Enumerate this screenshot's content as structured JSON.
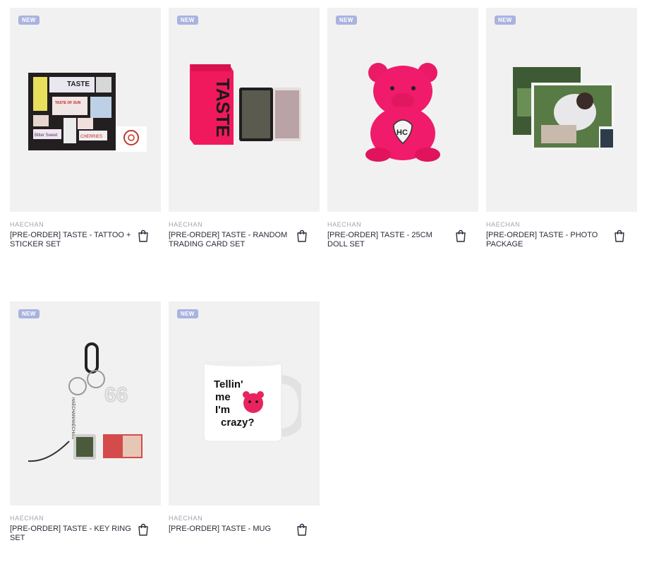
{
  "products": [
    {
      "badge": "NEW",
      "brand": "HAECHAN",
      "title": "[PRE-ORDER] TASTE - TATTOO + STICKER SET",
      "art_labels": [
        "TASTE",
        "TASTE OF SUN",
        "Bitter Sweet",
        "TASTE",
        "CHERRIES"
      ]
    },
    {
      "badge": "NEW",
      "brand": "HAECHAN",
      "title": "[PRE-ORDER] TASTE - RANDOM TRADING CARD SET",
      "art_labels": [
        "TASTE"
      ]
    },
    {
      "badge": "NEW",
      "brand": "HAECHAN",
      "title": "[PRE-ORDER] TASTE - 25CM DOLL SET",
      "art_labels": [
        "HC"
      ]
    },
    {
      "badge": "NEW",
      "brand": "HAECHAN",
      "title": "[PRE-ORDER] TASTE - PHOTO PACKAGE",
      "art_labels": []
    },
    {
      "badge": "NEW",
      "brand": "HAECHAN",
      "title": "[PRE-ORDER] TASTE - KEY RING SET",
      "art_labels": [
        "HAECHANHAECHAN",
        "66"
      ]
    },
    {
      "badge": "NEW",
      "brand": "HAECHAN",
      "title": "[PRE-ORDER] TASTE - MUG",
      "art_labels": [
        "Tellin'",
        "me",
        "I'm",
        "crazy?"
      ]
    }
  ],
  "icons": {
    "cart": "shopping-bag-icon"
  },
  "colors": {
    "badge": "#aab3e0",
    "thumb_bg": "#f1f1f1",
    "brand": "#a3a3ad",
    "pink": "#f0195e"
  }
}
